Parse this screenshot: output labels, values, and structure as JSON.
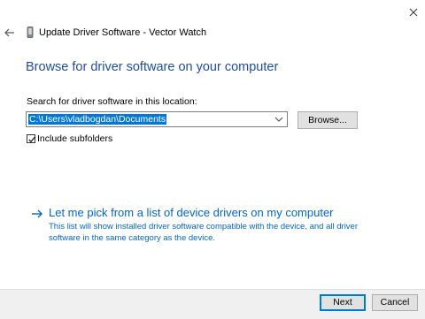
{
  "window": {
    "title": "Update Driver Software - Vector Watch",
    "close_icon": "close-icon",
    "back_icon": "back-arrow-icon",
    "device_icon": "device-icon"
  },
  "page": {
    "heading": "Browse for driver software on your computer",
    "location_label": "Search for driver software in this location:",
    "location_value": "C:\\Users\\vladbogdan\\Documents",
    "browse_label": "Browse...",
    "include_subfolders_label": "Include subfolders",
    "include_subfolders_checked": true
  },
  "pick_link": {
    "title": "Let me pick from a list of device drivers on my computer",
    "description": "This list will show installed driver software compatible with the device, and all driver software in the same category as the device.",
    "icon": "arrow-right-icon"
  },
  "footer": {
    "next_label": "Next",
    "cancel_label": "Cancel"
  },
  "colors": {
    "heading": "#1f4e9c",
    "link": "#0066cc",
    "selection": "#0078d7"
  }
}
